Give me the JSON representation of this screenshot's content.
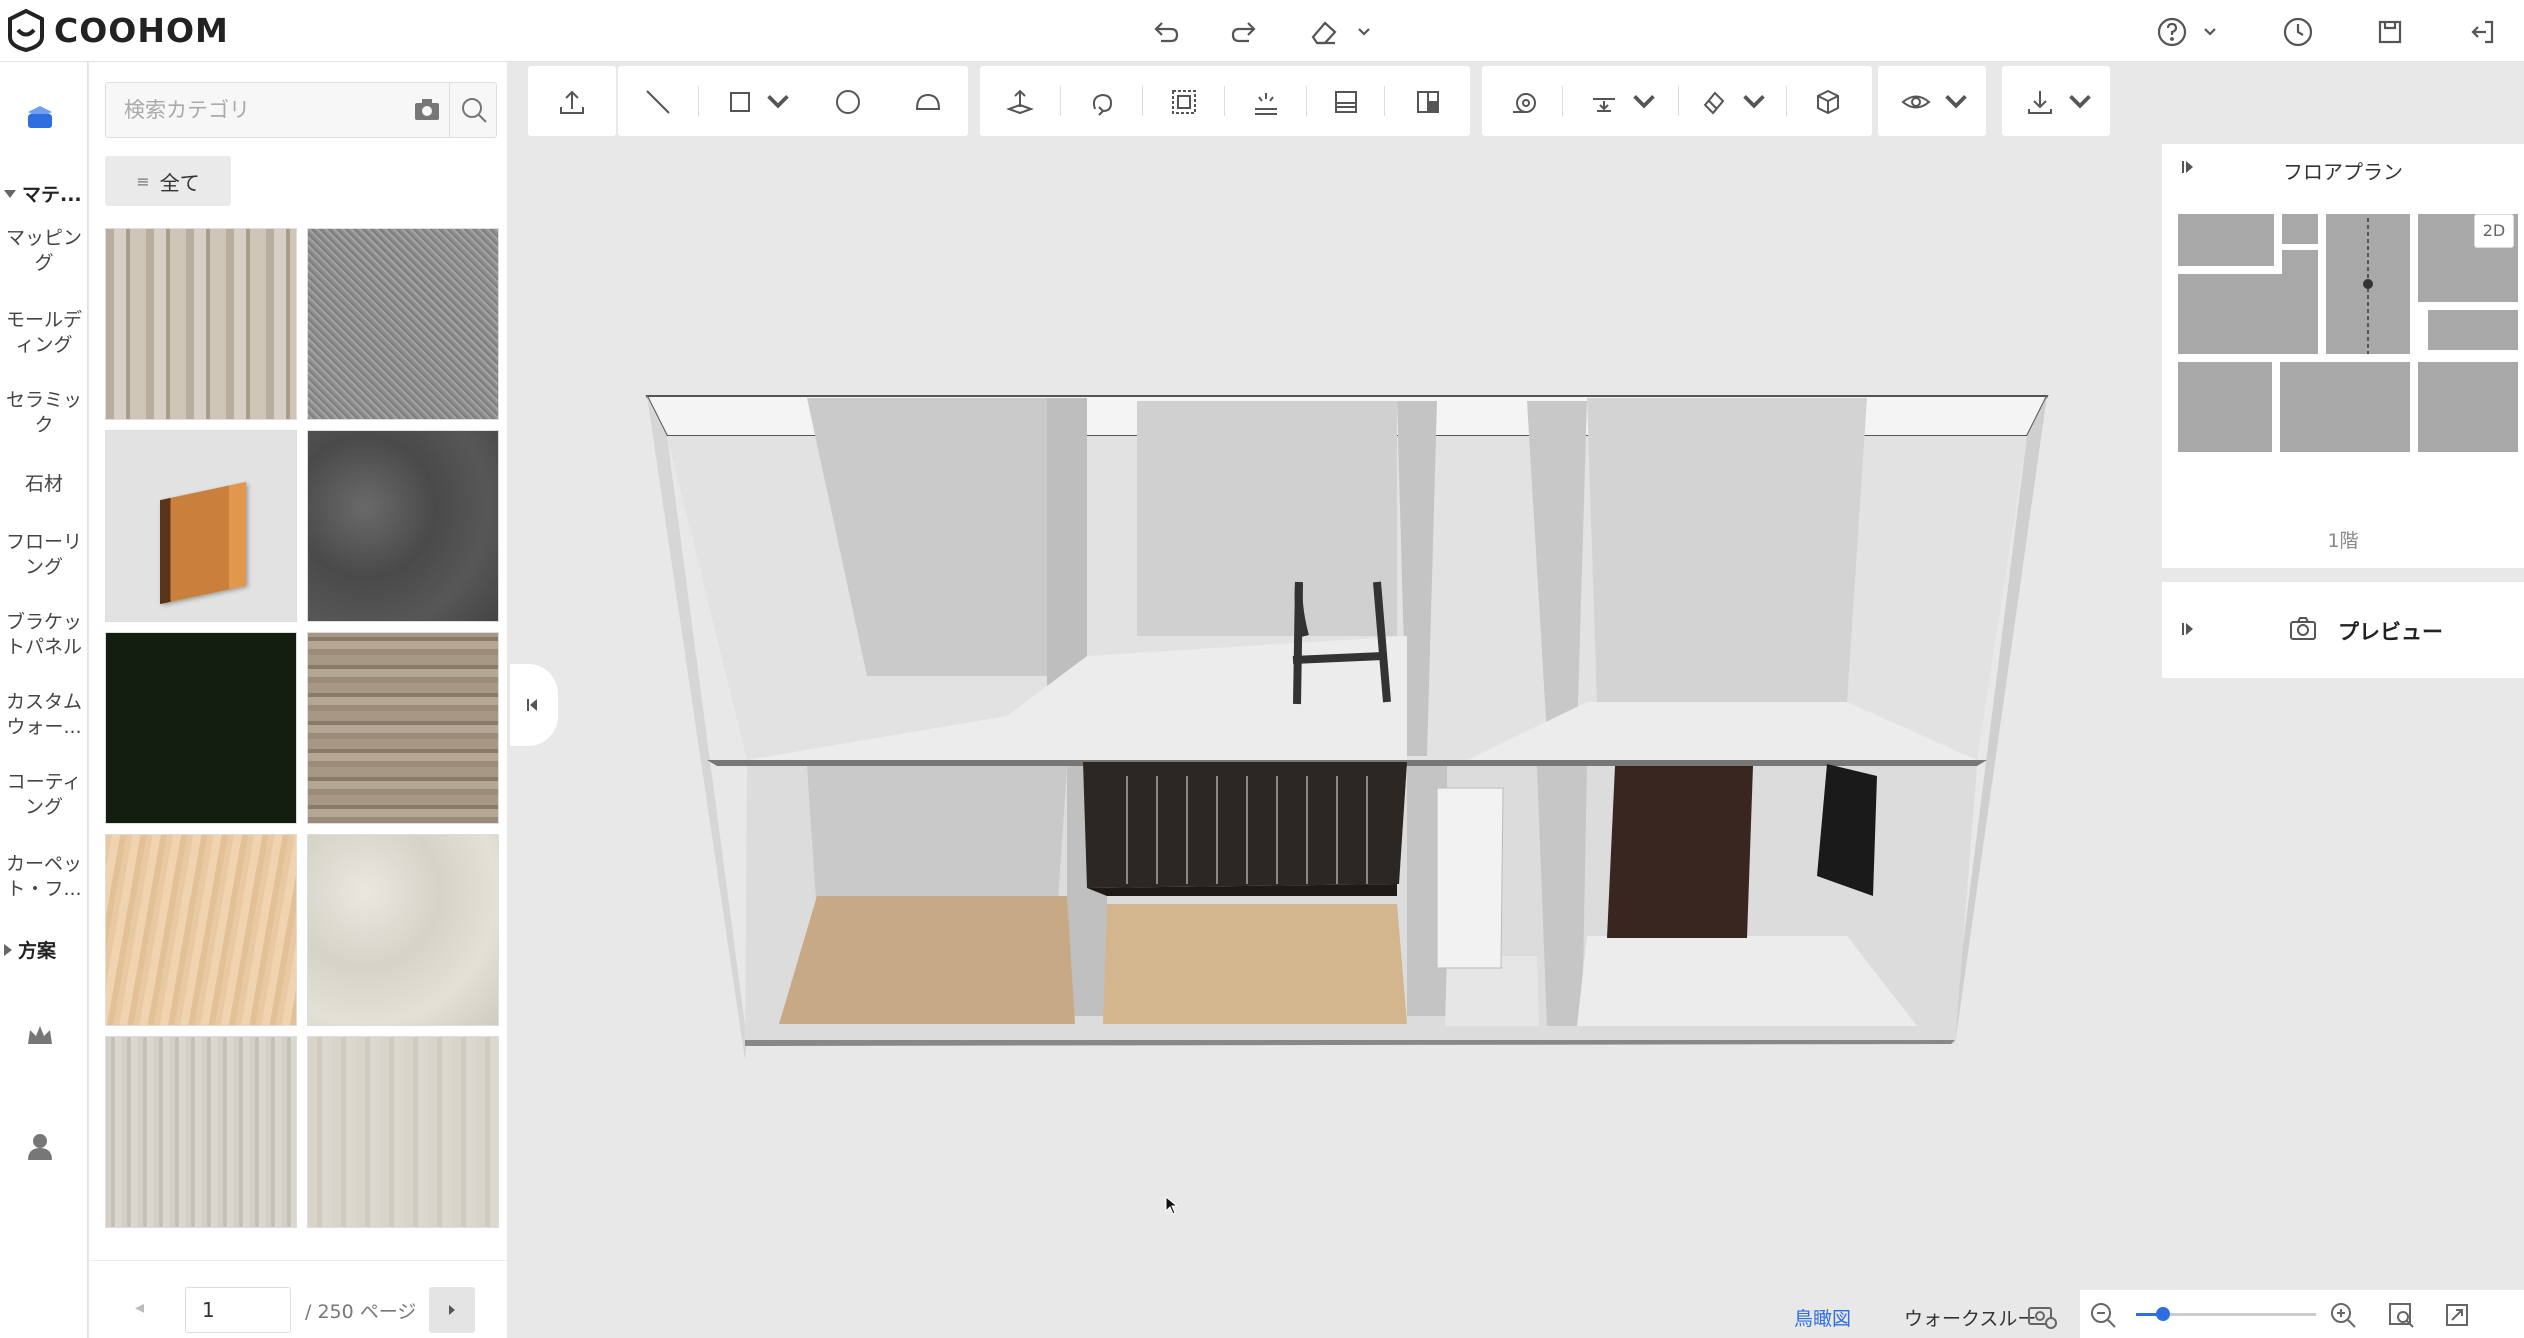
{
  "app": {
    "logo_text": "COOHOM"
  },
  "search": {
    "placeholder": "検索カテゴリ"
  },
  "filter": {
    "all_label": "全て"
  },
  "nav": {
    "material_heading": "マテ...",
    "items": [
      "マッピング",
      "モールディング",
      "セラミック",
      "石材",
      "フローリング",
      "ブラケットパネル",
      "カスタムウォー...",
      "コーティング",
      "カーペット・フ..."
    ],
    "scheme_heading": "方案"
  },
  "pager": {
    "current": "1",
    "total_label": "/ 250 ページ"
  },
  "floorplan": {
    "title": "フロアプラン",
    "badge": "2D",
    "floor_label": "1階"
  },
  "preview": {
    "title": "プレビュー"
  },
  "view_modes": {
    "aerial": "鳥瞰図",
    "walk": "ウォークスルー"
  },
  "zoom": {
    "level": 0.15
  },
  "colors": {
    "accent": "#2d6fe0",
    "panel_bg": "#ffffff",
    "canvas_bg": "#e8e8e8"
  },
  "icons": [
    "undo-icon",
    "redo-icon",
    "eraser-icon",
    "help-icon",
    "history-icon",
    "save-icon",
    "exit-icon",
    "upload-icon",
    "line-icon",
    "rectangle-icon",
    "circle-icon",
    "arc-icon",
    "export-icon",
    "eye-icon",
    "download-icon"
  ]
}
